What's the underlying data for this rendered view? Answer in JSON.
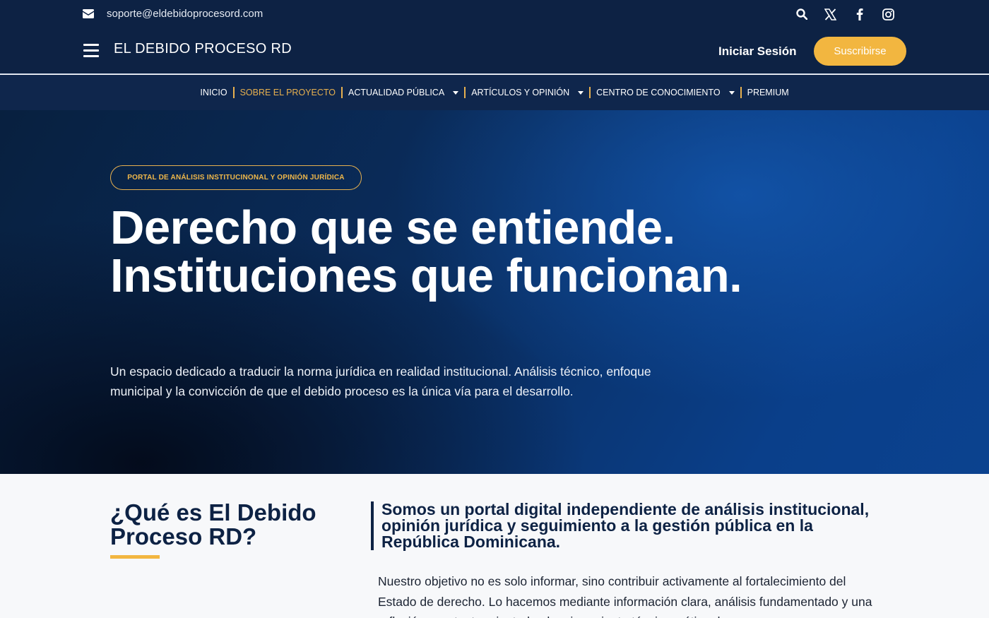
{
  "header": {
    "email": "soporte@eldebidoprocesord.com",
    "brand": "EL DEBIDO PROCESO RD",
    "login_label": "Iniciar Sesión",
    "subscribe_label": "Suscribirse",
    "social_icons": [
      "search-icon",
      "x-icon",
      "facebook-icon",
      "instagram-icon"
    ]
  },
  "nav": {
    "items": [
      {
        "label": "INICIO"
      },
      {
        "label": "SOBRE EL PROYECTO",
        "active": true
      },
      {
        "label": "ACTUALIDAD PÚBLICA",
        "dropdown": true
      },
      {
        "label": "ARTÍCULOS Y OPINIÓN",
        "dropdown": true
      },
      {
        "label": "CENTRO DE CONOCIMIENTO",
        "dropdown": true
      },
      {
        "label": "PREMIUM"
      }
    ]
  },
  "hero": {
    "badge": "PORTAL DE ANÁLISIS INSTITUCINONAL Y OPINIÓN JURÍDICA",
    "title": "Derecho que se entiende. Instituciones que funcionan.",
    "subtitle": "Un espacio dedicado a traducir la norma jurídica en realidad institucional. Análisis técnico, enfoque municipal y la convicción de que el debido proceso es la única vía para el desarrollo."
  },
  "about": {
    "heading": "¿Qué es El Debido Proceso RD?",
    "quote": "Somos un portal digital independiente de análisis institucional, opinión jurídica y seguimiento a la gestión pública en la República Dominicana.",
    "body": "Nuestro objetivo no es solo informar, sino contribuir activamente al fortalecimiento del Estado de derecho. Lo hacemos mediante información clara, análisis fundamentado y una reflexión constante orientada al mejoramiento técnico y ético de"
  },
  "colors": {
    "navy": "#0d2244",
    "accent": "#f2b640",
    "active_nav": "#e7b04f"
  }
}
